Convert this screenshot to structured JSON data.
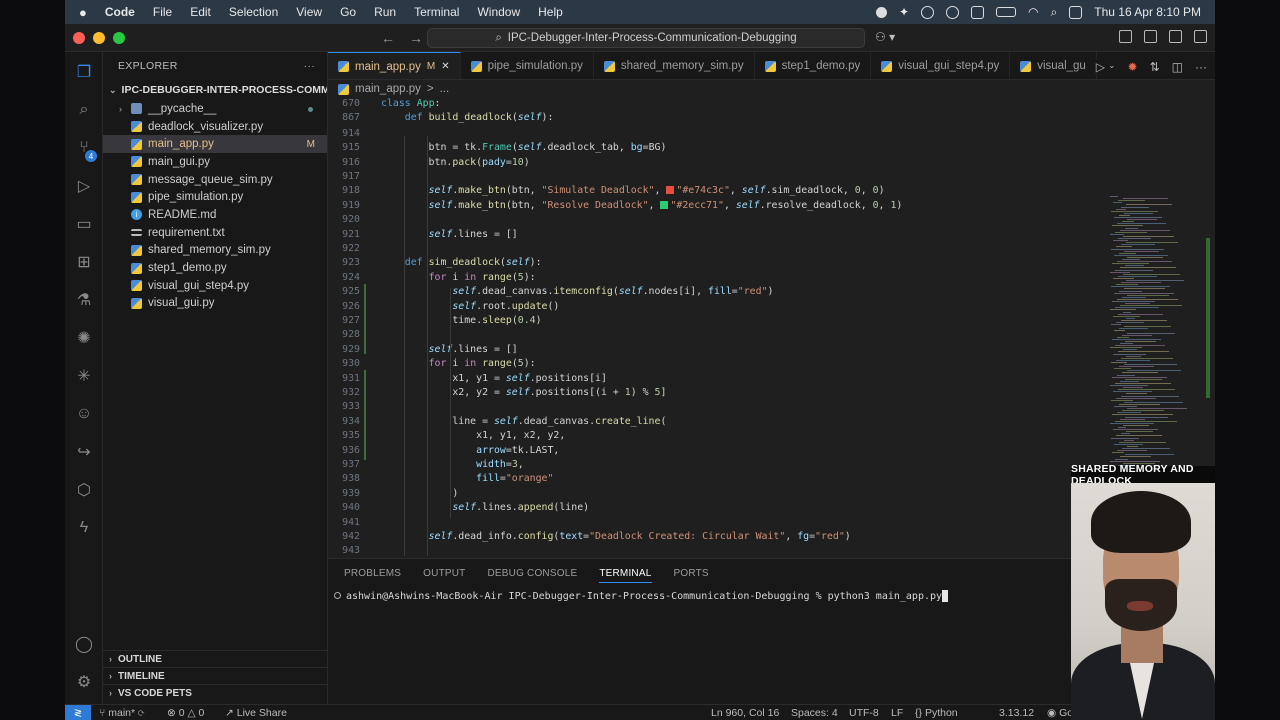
{
  "menubar": {
    "apple": "",
    "app": "Code",
    "items": [
      "File",
      "Edit",
      "Selection",
      "View",
      "Go",
      "Run",
      "Terminal",
      "Window",
      "Help"
    ],
    "clock": "Thu 16 Apr  8:10 PM"
  },
  "titlebar": {
    "command_center": "IPC-Debugger-Inter-Process-Communication-Debugging"
  },
  "sidebar": {
    "title": "EXPLORER",
    "more": "···",
    "root": "IPC-DEBUGGER-INTER-PROCESS-COMMUNI...",
    "items": [
      {
        "label": "__pycache__",
        "kind": "folder"
      },
      {
        "label": "deadlock_visualizer.py",
        "kind": "py"
      },
      {
        "label": "main_app.py",
        "kind": "py",
        "flag": "M"
      },
      {
        "label": "main_gui.py",
        "kind": "py"
      },
      {
        "label": "message_queue_sim.py",
        "kind": "py"
      },
      {
        "label": "pipe_simulation.py",
        "kind": "py"
      },
      {
        "label": "README.md",
        "kind": "info"
      },
      {
        "label": "requirement.txt",
        "kind": "txt"
      },
      {
        "label": "shared_memory_sim.py",
        "kind": "py"
      },
      {
        "label": "step1_demo.py",
        "kind": "py"
      },
      {
        "label": "visual_gui_step4.py",
        "kind": "py"
      },
      {
        "label": "visual_gui.py",
        "kind": "py"
      }
    ],
    "sections": [
      "OUTLINE",
      "TIMELINE",
      "VS CODE PETS"
    ]
  },
  "activity": {
    "scm_badge": "4"
  },
  "tabs": [
    {
      "label": "main_app.py",
      "flag": "M",
      "close": "✕"
    },
    {
      "label": "pipe_simulation.py"
    },
    {
      "label": "shared_memory_sim.py"
    },
    {
      "label": "step1_demo.py"
    },
    {
      "label": "visual_gui_step4.py"
    },
    {
      "label": "visual_gu"
    }
  ],
  "breadcrumb": {
    "file": "main_app.py",
    "sep": ">",
    "rest": "..."
  },
  "editor": {
    "lines": [
      {
        "n": "670",
        "html": "<span class='kwb'>class</span> <span class='cls'>App</span>:"
      },
      {
        "n": "867",
        "html": "    <span class='kwb'>def</span> <span class='fn'>build_deadlock</span>(<span class='self'>self</span>):"
      },
      {
        "n": "914",
        "html": ""
      },
      {
        "n": "915",
        "html": "        btn = tk.<span class='cls'>Frame</span>(<span class='self'>self</span>.deadlock_tab, <span class='prm'>bg</span>=BG)"
      },
      {
        "n": "916",
        "html": "        btn.<span class='fn'>pack</span>(<span class='prm'>pady</span>=<span class='num'>10</span>)"
      },
      {
        "n": "917",
        "html": ""
      },
      {
        "n": "918",
        "html": "        <span class='self'>self</span>.<span class='fn'>make_btn</span>(btn, <span class='str'>\"Simulate Deadlock\"</span>, <span class='swatch' style='background:#e74c3c'></span><span class='str'>\"#e74c3c\"</span>, <span class='self'>self</span>.sim_deadlock, <span class='num'>0</span>, <span class='num'>0</span>)"
      },
      {
        "n": "919",
        "html": "        <span class='self'>self</span>.<span class='fn'>make_btn</span>(btn, <span class='str'>\"Resolve Deadlock\"</span>, <span class='swatch' style='background:#2ecc71'></span><span class='str'>\"#2ecc71\"</span>, <span class='self'>self</span>.resolve_deadlock, <span class='num'>0</span>, <span class='num'>1</span>)"
      },
      {
        "n": "920",
        "html": ""
      },
      {
        "n": "921",
        "html": "        <span class='self'>self</span>.lines = []"
      },
      {
        "n": "922",
        "html": ""
      },
      {
        "n": "923",
        "html": "    <span class='kwb'>def</span> <span class='fn'>sim_deadlock</span>(<span class='self'>self</span>):"
      },
      {
        "n": "924",
        "html": "        <span class='kw'>for</span> i <span class='kw'>in</span> <span class='fn'>range</span>(<span class='num'>5</span>):"
      },
      {
        "n": "925",
        "html": "            <span class='self'>self</span>.dead_canvas.<span class='fn'>itemconfig</span>(<span class='self'>self</span>.nodes[i], <span class='prm'>fill</span>=<span class='str'>\"red\"</span>)"
      },
      {
        "n": "926",
        "html": "            <span class='self'>self</span>.root.<span class='fn'>update</span>()"
      },
      {
        "n": "927",
        "html": "            time.<span class='fn'>sleep</span>(<span class='num'>0.4</span>)"
      },
      {
        "n": "928",
        "html": ""
      },
      {
        "n": "929",
        "html": "        <span class='self'>self</span>.lines = []"
      },
      {
        "n": "930",
        "html": "        <span class='kw'>for</span> i <span class='kw'>in</span> <span class='fn'>range</span>(<span class='num'>5</span>):"
      },
      {
        "n": "931",
        "html": "            x1, y1 = <span class='self'>self</span>.positions[i]"
      },
      {
        "n": "932",
        "html": "            x2, y2 = <span class='self'>self</span>.positions[(i + <span class='num'>1</span>) % <span class='num'>5</span>]"
      },
      {
        "n": "933",
        "html": ""
      },
      {
        "n": "934",
        "html": "            line = <span class='self'>self</span>.dead_canvas.<span class='fn'>create_line</span>("
      },
      {
        "n": "935",
        "html": "                x1, y1, x2, y2,"
      },
      {
        "n": "936",
        "html": "                <span class='prm'>arrow</span>=tk.LAST,"
      },
      {
        "n": "937",
        "html": "                <span class='prm'>width</span>=<span class='num'>3</span>,"
      },
      {
        "n": "938",
        "html": "                <span class='prm'>fill</span>=<span class='str'>\"orange\"</span>"
      },
      {
        "n": "939",
        "html": "            )"
      },
      {
        "n": "940",
        "html": "            <span class='self'>self</span>.lines.<span class='fn'>append</span>(line)"
      },
      {
        "n": "941",
        "html": ""
      },
      {
        "n": "942",
        "html": "        <span class='self'>self</span>.dead_info.<span class='fn'>config</span>(<span class='prm'>text</span>=<span class='str'>\"Deadlock Created: Circular Wait\"</span>, <span class='prm'>fg</span>=<span class='str'>\"red\"</span>)"
      },
      {
        "n": "943",
        "html": ""
      }
    ]
  },
  "panel": {
    "tabs": [
      "PROBLEMS",
      "OUTPUT",
      "DEBUG CONSOLE",
      "TERMINAL",
      "PORTS"
    ],
    "active_tab": "TERMINAL",
    "shell": "zs",
    "prompt": "ashwin@Ashwins-MacBook-Air IPC-Debugger-Inter-Process-Communication-Debugging % python3 main_app.py"
  },
  "statusbar": {
    "branch": "main*",
    "errors": "0",
    "warnings": "0",
    "live_share": "Live Share",
    "position": "Ln 960, Col 16",
    "spaces": "Spaces: 4",
    "encoding": "UTF-8",
    "eol": "LF",
    "language": "Python",
    "interpreter": "3.13.12",
    "trailing": "Go"
  },
  "overlay": {
    "title": "SHARED MEMORY AND DEADLOCK"
  },
  "colors": {
    "accent": "#2f8ef4",
    "red_swatch": "#e74c3c",
    "green_swatch": "#2ecc71"
  }
}
